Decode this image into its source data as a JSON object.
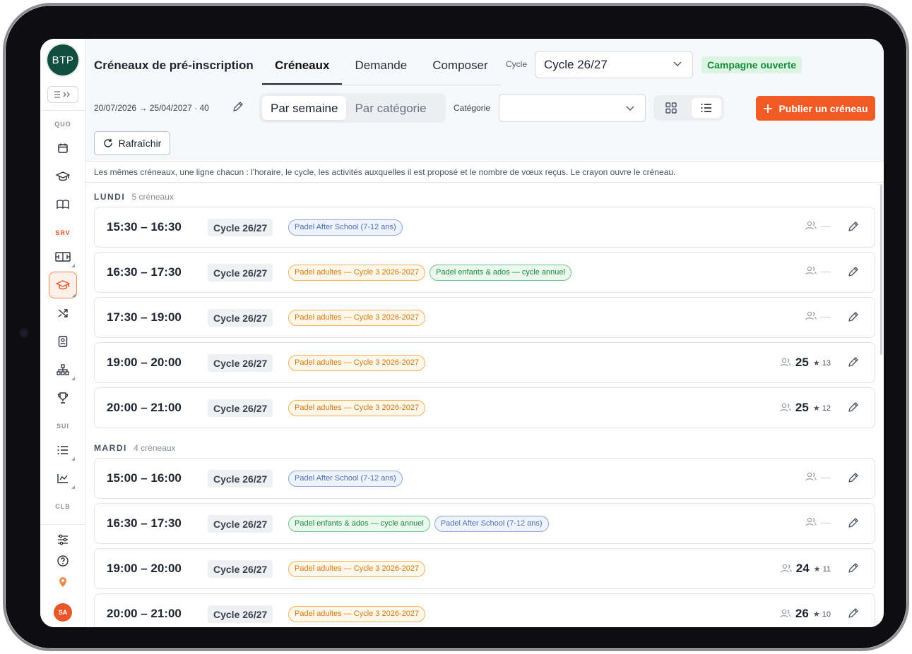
{
  "app": {
    "logo": "BTP",
    "user_initials": "SA"
  },
  "sidebar": {
    "sections": [
      "QUO",
      "SRV",
      "SUI",
      "CLB"
    ],
    "icons": [
      "calendar-icon",
      "graduation-cap-icon",
      "book-icon",
      "court-icon",
      "graduation-cap-icon",
      "shuffle-icon",
      "id-badge-icon",
      "org-chart-icon",
      "trophy-icon",
      "list-icon",
      "chart-icon",
      "sliders-icon",
      "help-icon",
      "location-pin-icon"
    ]
  },
  "header": {
    "title": "Créneaux de pré-inscription",
    "tabs": [
      "Créneaux",
      "Demande",
      "Composer"
    ],
    "cycle_label": "Cycle",
    "cycle_value": "Cycle 26/27",
    "status_badge": "Campagne ouverte",
    "range": "20/07/2026 → 25/04/2027 · 40",
    "group_by": [
      "Par semaine",
      "Par catégorie"
    ],
    "category_label": "Catégorie",
    "category_value": "",
    "publish_label": "Publier un créneau",
    "refresh_label": "Rafraîchir"
  },
  "hint": "Les mêmes créneaux, une ligne chacun : l'horaire, le cycle, les activités auxquelles il est proposé et le nombre de vœux reçus. Le crayon ouvre le créneau.",
  "days": [
    {
      "name": "LUNDI",
      "count": "5 créneaux",
      "slots": [
        {
          "time": "15:30 – 16:30",
          "cycle": "Cycle 26/27",
          "activities": [
            {
              "label": "Padel After School (7-12 ans)",
              "color": "blue"
            }
          ],
          "wishes": "—",
          "stars": ""
        },
        {
          "time": "16:30 – 17:30",
          "cycle": "Cycle 26/27",
          "activities": [
            {
              "label": "Padel adultes — Cycle 3 2026-2027",
              "color": "orange"
            },
            {
              "label": "Padel enfants & ados — cycle annuel",
              "color": "green"
            }
          ],
          "wishes": "—",
          "stars": ""
        },
        {
          "time": "17:30 – 19:00",
          "cycle": "Cycle 26/27",
          "activities": [
            {
              "label": "Padel adultes — Cycle 3 2026-2027",
              "color": "orange"
            }
          ],
          "wishes": "—",
          "stars": ""
        },
        {
          "time": "19:00 – 20:00",
          "cycle": "Cycle 26/27",
          "activities": [
            {
              "label": "Padel adultes — Cycle 3 2026-2027",
              "color": "orange"
            }
          ],
          "wishes": "25",
          "stars": "★ 13"
        },
        {
          "time": "20:00 – 21:00",
          "cycle": "Cycle 26/27",
          "activities": [
            {
              "label": "Padel adultes — Cycle 3 2026-2027",
              "color": "orange"
            }
          ],
          "wishes": "25",
          "stars": "★ 12"
        }
      ]
    },
    {
      "name": "MARDI",
      "count": "4 créneaux",
      "slots": [
        {
          "time": "15:00 – 16:00",
          "cycle": "Cycle 26/27",
          "activities": [
            {
              "label": "Padel After School (7-12 ans)",
              "color": "blue"
            }
          ],
          "wishes": "—",
          "stars": ""
        },
        {
          "time": "16:30 – 17:30",
          "cycle": "Cycle 26/27",
          "activities": [
            {
              "label": "Padel enfants & ados — cycle annuel",
              "color": "green"
            },
            {
              "label": "Padel After School (7-12 ans)",
              "color": "blue"
            }
          ],
          "wishes": "—",
          "stars": ""
        },
        {
          "time": "19:00 – 20:00",
          "cycle": "Cycle 26/27",
          "activities": [
            {
              "label": "Padel adultes — Cycle 3 2026-2027",
              "color": "orange"
            }
          ],
          "wishes": "24",
          "stars": "★ 11"
        },
        {
          "time": "20:00 – 21:00",
          "cycle": "Cycle 26/27",
          "activities": [
            {
              "label": "Padel adultes — Cycle 3 2026-2027",
              "color": "orange"
            }
          ],
          "wishes": "26",
          "stars": "★ 10"
        }
      ]
    }
  ],
  "colors": {
    "accent": "#f05a24",
    "logo": "#124e3f",
    "open_badge_bg": "#dcf5e3",
    "open_badge_text": "#138a3c"
  }
}
